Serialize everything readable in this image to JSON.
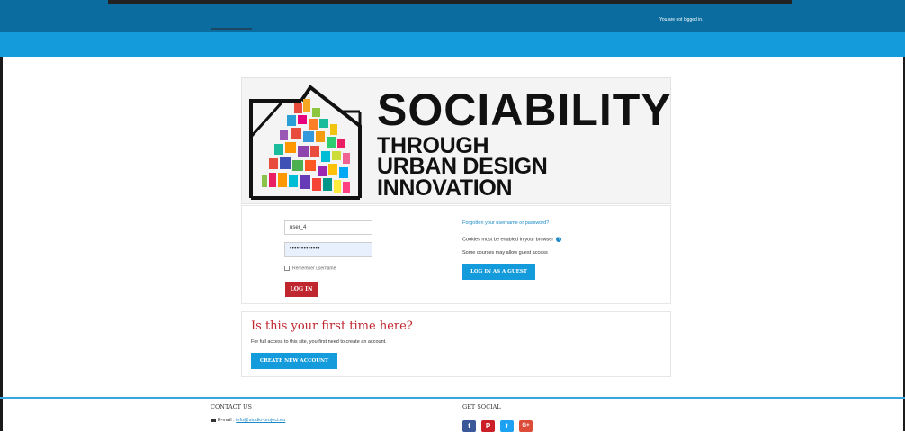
{
  "header": {
    "login_status": "You are not logged in."
  },
  "logo": {
    "title": "SOCIABILITY",
    "line1": "THROUGH",
    "line2": "URBAN DESIGN",
    "line3": "INNOVATION"
  },
  "login": {
    "username_value": "user_4",
    "password_value": "•••••••••••••",
    "remember_label": "Remember username",
    "login_button": "LOG IN",
    "forgot_link": "Forgotten your username or password?",
    "cookies_text": "Cookies must be enabled in your browser",
    "guest_text": "Some courses may allow guest access",
    "guest_button": "LOG IN AS A GUEST"
  },
  "signup": {
    "title": "Is this your first time here?",
    "description": "For full access to this site, you first need to create an account.",
    "create_button": "CREATE NEW ACCOUNT"
  },
  "footer": {
    "contact_title": "CONTACT US",
    "email_label": "E-mail : ",
    "email": "info@studio-project.eu",
    "social_title": "GET SOCIAL",
    "social_icons": [
      "facebook-icon",
      "pinterest-icon",
      "twitter-icon",
      "google-plus-icon"
    ]
  },
  "colors": {
    "topbar": "#0b6d9f",
    "subbar": "#149bdc",
    "accent_red": "#c0262e",
    "accent_blue": "#149bdc"
  }
}
